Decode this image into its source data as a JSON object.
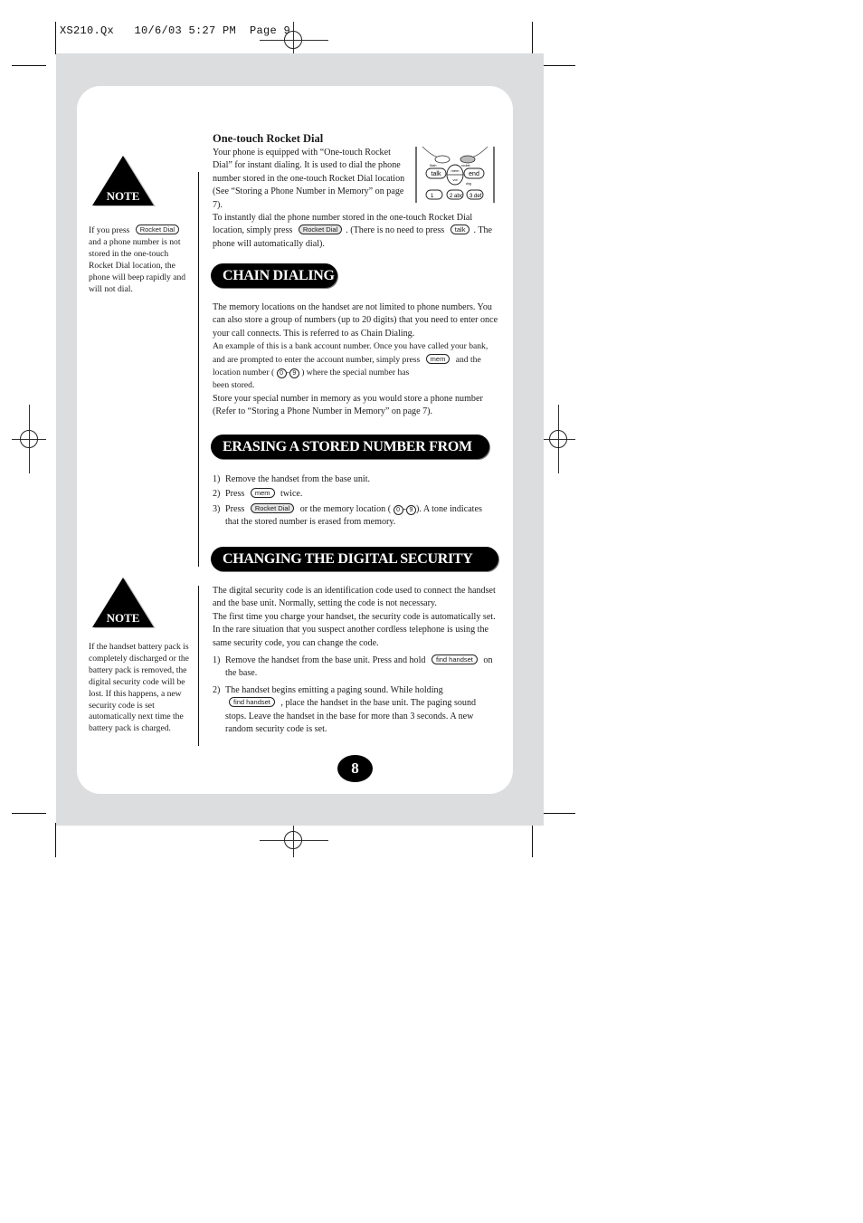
{
  "slug_line": "XS210.Qx   10/6/03 5:27 PM  Page 9",
  "sidebar": {
    "notes": [
      {
        "badge": "NOTE",
        "text_parts": [
          "If you press",
          "Rocket Dial",
          "and a phone number is not stored in the one-touch Rocket Dial location, the phone will beep rapidly and will not dial."
        ]
      },
      {
        "badge": "NOTE",
        "text": "If the handset battery pack is completely discharged or the battery pack is removed, the digital security code will be lost. If this happens, a new security code is set automatically next time the battery pack is charged."
      }
    ]
  },
  "rocket_dial": {
    "heading": "One-touch Rocket Dial",
    "para1": "Your phone is equipped with “One-touch Rocket Dial” for instant dialing.  It is used to dial the phone number stored in the one-touch Rocket Dial location (See “Storing a Phone Number in Memory” on page 7).",
    "para2_a": "To instantly dial the phone number stored in the one-touch Rocket Dial location, simply press",
    "para2_btn1": "Rocket Dial",
    "para2_b": ".  (There is no need to press",
    "para2_btn2": "talk",
    "para2_c": ". The phone will automatically dial).",
    "keypad": {
      "keys": [
        "talk",
        "mem",
        "vol",
        "end",
        "1",
        "2 abc",
        "3 def"
      ],
      "small_labels": [
        "flash",
        "rocket",
        "dng"
      ]
    }
  },
  "chain_dialing": {
    "title": "CHAIN DIALING",
    "p1": "The memory locations on the handset are not limited to phone numbers. You can also store a group of numbers (up to 20 digits) that you need to enter once your call connects. This is referred to as Chain Dialing.",
    "p2_a": "An example of this is a bank account number. Once you have called your bank, and are prompted to enter the account number, simply press",
    "p2_btn": "mem",
    "p2_b": "and the location number (",
    "p2_from": "0",
    "p2_to": "9",
    "p2_c": ") where the special number has",
    "p2_d": "been stored.",
    "p3": "Store your special number in memory as you would store a phone number (Refer to “Storing a Phone Number in Memory” on page 7)."
  },
  "erasing": {
    "title": "ERASING A STORED NUMBER FROM MEMORY",
    "steps": [
      {
        "n": "1)",
        "text": "Remove the handset from the base unit."
      },
      {
        "n": "2)",
        "a": "Press",
        "btn": "mem",
        "b": "twice."
      },
      {
        "n": "3)",
        "a": "Press",
        "btn": "Rocket Dial",
        "b": "or the memory location (",
        "from": "0",
        "to": "9",
        "c": "). A tone indicates that the stored number is erased from memory."
      }
    ]
  },
  "security": {
    "title": "CHANGING THE DIGITAL SECURITY CODE",
    "p1": "The digital security code is an identification code used to connect the handset and the base unit. Normally, setting the code is not necessary.",
    "p2": "The first time you charge your handset, the security code is automatically set. In the rare situation that you suspect another cordless telephone is using the same security code, you can change the code.",
    "steps": [
      {
        "n": "1)",
        "a": "Remove the handset from the base unit. Press and hold",
        "btn": "find handset",
        "b": "on the base."
      },
      {
        "n": "2)",
        "a": "The handset begins emitting a paging sound. While holding",
        "btn": "find handset",
        "b": ", place the handset in the base unit. The paging sound stops. Leave the handset in the base for more than 3 seconds. A new random security code is set."
      }
    ]
  },
  "page_number": "8",
  "colors": {
    "panel_gray": "#dcdddf",
    "banner_black": "#000000",
    "text": "#1a1a1a"
  }
}
